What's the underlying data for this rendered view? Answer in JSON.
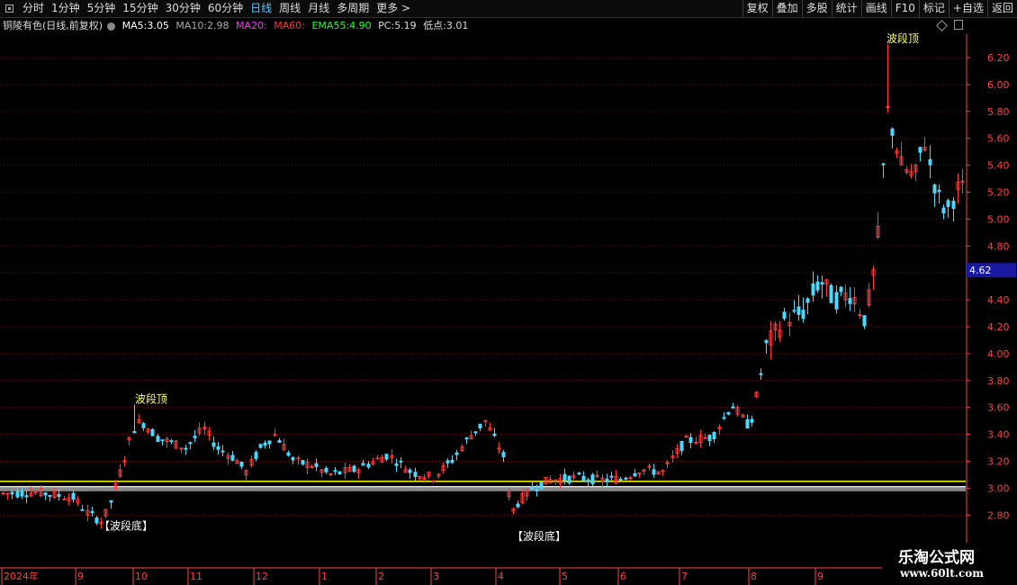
{
  "toolbar": {
    "periods": [
      "分时",
      "1分钟",
      "5分钟",
      "15分钟",
      "30分钟",
      "60分钟",
      "日线",
      "周线",
      "月线",
      "多周期",
      "更多 >"
    ],
    "active_period": "日线",
    "right_buttons": [
      "复权",
      "叠加",
      "多股",
      "统计",
      "画线",
      "F10",
      "标记",
      "+自选",
      "返回"
    ]
  },
  "info": {
    "stock": "铜陵有色(日线,前复权)",
    "ma5_label": "MA5:",
    "ma5_value": "3.05",
    "ma10_label": "MA10:",
    "ma10_value": "2.98",
    "ma20_label": "MA20:",
    "ma60_label": "MA60:",
    "ema55_label": "EMA55:",
    "ema55_value": "4.90",
    "pc_label": "PC:",
    "pc_value": "5.19",
    "low_label": "低点:",
    "low_value": "3.01"
  },
  "colors": {
    "up": "#ff3b3b",
    "down": "#4fd8ff",
    "ma5": "#ffffff",
    "ma10": "#ffff00",
    "ma20": "#ff00ff",
    "ma60": "#ff3333",
    "ema55": "#00ff00",
    "grid": "#7a0000",
    "axis": "#ff4040",
    "price_tag_bg": "#1a1aa0",
    "annot": "#ffff66"
  },
  "chart_data": {
    "type": "candlestick",
    "y_ticks": [
      "6.20",
      "6.00",
      "5.80",
      "5.60",
      "5.40",
      "5.20",
      "5.00",
      "4.80",
      "4.60",
      "4.40",
      "4.20",
      "4.00",
      "3.80",
      "3.60",
      "3.40",
      "3.20",
      "3.00",
      "2.80"
    ],
    "ylim": [
      2.75,
      6.42
    ],
    "x_labels": [
      "2024年",
      "9",
      "10",
      "11",
      "12",
      "1",
      "2",
      "3",
      "4",
      "5",
      "6",
      "7",
      "8",
      "9"
    ],
    "current_price_tag": "4.62",
    "horizontal_lines": [
      {
        "value": 3.05,
        "color": "#ffff00"
      },
      {
        "value": 3.01,
        "color": "#ffffff"
      },
      {
        "value": 2.99,
        "color": "#888888"
      }
    ],
    "annotations": [
      {
        "text": "波段顶",
        "price": 3.66
      },
      {
        "text": "【波段底】",
        "price": 2.72
      },
      {
        "text": "【波段底】",
        "price": 2.64
      },
      {
        "text": "波段顶",
        "price": 6.34
      }
    ]
  },
  "watermark": {
    "title": "乐淘公式网",
    "url": "www.60lt.com"
  }
}
